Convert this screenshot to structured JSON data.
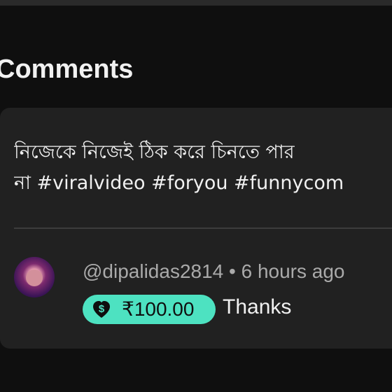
{
  "header": {
    "title": "Comments"
  },
  "description": {
    "line1": "নিজেকে নিজেই ঠিক করে চিনতে পার",
    "line2": "না #viralvideo #foryou #funnycom"
  },
  "comment": {
    "meta": "@dipalidas2814 • 6 hours ago",
    "tip_icon": "dollar-heart-icon",
    "tip_amount": "₹100.00",
    "text": "Thanks",
    "tip_color": "#4de2c1"
  }
}
